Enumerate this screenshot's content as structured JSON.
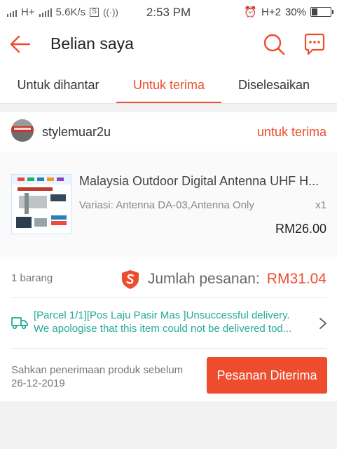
{
  "status_bar": {
    "network": "H+",
    "speed": "5.6K/s",
    "time": "2:53 PM",
    "network_right": "H+2",
    "battery_percent": "30%",
    "battery_level": 0.3
  },
  "header": {
    "title": "Belian saya",
    "icons": [
      "back-arrow-icon",
      "search-icon",
      "chat-icon"
    ],
    "accent_color": "#ee4d2d"
  },
  "tabs": [
    {
      "label": "Untuk dihantar",
      "active": false
    },
    {
      "label": "Untuk terima",
      "active": true
    },
    {
      "label": "Diselesaikan",
      "active": false
    }
  ],
  "order": {
    "shop_name": "stylemuar2u",
    "status": "untuk terima",
    "product": {
      "name": "Malaysia Outdoor Digital Antenna UHF H...",
      "variation": "Variasi: Antenna DA-03,Antenna Only",
      "quantity": "x1",
      "price": "RM26.00"
    },
    "items_count": "1 barang",
    "total_label": "Jumlah pesanan:",
    "total_amount": "RM31.04",
    "tracking": {
      "line1": "[Parcel 1/1][Pos Laju Pasir Mas ]Unsuccessful delivery.",
      "line2": "We apologise that this item could not be delivered tod...",
      "color": "#26aa99"
    },
    "confirm_note_line1": "Sahkan penerimaan produk sebelum",
    "confirm_note_line2": "26-12-2019",
    "confirm_button": "Pesanan Diterima"
  }
}
